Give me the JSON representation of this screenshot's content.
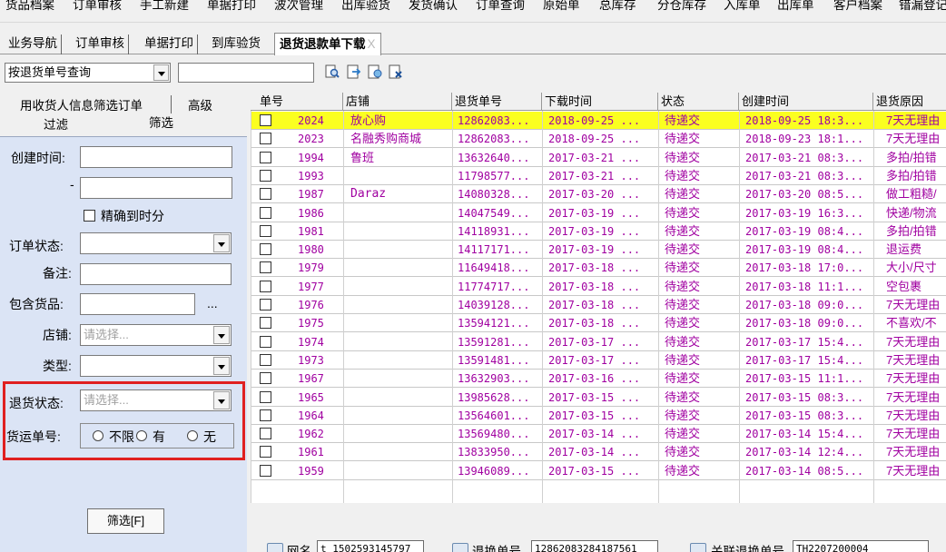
{
  "menu": [
    "货品档案",
    "订单审核",
    "手工新建",
    "单据打印",
    "波次管理",
    "出库验货",
    "发货确认",
    "订单查询",
    "原始单",
    "总库存",
    "分仓库存",
    "入库单",
    "出库单",
    "客户档案",
    "错漏登记"
  ],
  "tabs": [
    {
      "label": "业务导航"
    },
    {
      "label": "订单审核"
    },
    {
      "label": "单据打印"
    },
    {
      "label": "到库验货"
    },
    {
      "label": "退货退款单下载",
      "close": "X"
    }
  ],
  "search": {
    "mode": "按退货单号查询",
    "value": ""
  },
  "toolbar_icons": [
    "search-icon",
    "import-icon",
    "export-icon",
    "clear-icon"
  ],
  "left_tabs": {
    "row1_a": "用收货人信息筛选订单",
    "row1_b": "高级",
    "row2_a": "过滤",
    "row2_b": "筛选"
  },
  "filter": {
    "created_time": "创建时间:",
    "dash": "-",
    "precise": "精确到时分",
    "order_status": "订单状态:",
    "note": "备注:",
    "contains_goods": "包含货品:",
    "dots": "...",
    "shop": "店铺:",
    "shop_placeholder": "请选择...",
    "type": "类型:",
    "return_status": "退货状态:",
    "return_placeholder": "请选择...",
    "tracking_no": "货运单号:",
    "radio_all": "不限",
    "radio_yes": "有",
    "radio_no": "无",
    "filter_button": "筛选[F]"
  },
  "columns": [
    "单号",
    "店铺",
    "退货单号",
    "下载时间",
    "状态",
    "创建时间",
    "退货原因"
  ],
  "rows": [
    {
      "no": "2024",
      "shop": "放心购",
      "refund": "12862083...",
      "dl": "2018-09-25 ...",
      "status": "待递交",
      "created": "2018-09-25 18:3...",
      "reason": "7天无理由"
    },
    {
      "no": "2023",
      "shop": "名融秀购商城",
      "refund": "12862083...",
      "dl": "2018-09-25 ...",
      "status": "待递交",
      "created": "2018-09-23 18:1...",
      "reason": "7天无理由"
    },
    {
      "no": "1994",
      "shop": "鲁班",
      "refund": "13632640...",
      "dl": "2017-03-21 ...",
      "status": "待递交",
      "created": "2017-03-21 08:3...",
      "reason": "多拍/拍错"
    },
    {
      "no": "1993",
      "shop": "",
      "refund": "11798577...",
      "dl": "2017-03-21 ...",
      "status": "待递交",
      "created": "2017-03-21 08:3...",
      "reason": "多拍/拍错"
    },
    {
      "no": "1987",
      "shop": "Daraz",
      "refund": "14080328...",
      "dl": "2017-03-20 ...",
      "status": "待递交",
      "created": "2017-03-20 08:5...",
      "reason": "做工粗糙/"
    },
    {
      "no": "1986",
      "shop": "",
      "refund": "14047549...",
      "dl": "2017-03-19 ...",
      "status": "待递交",
      "created": "2017-03-19 16:3...",
      "reason": "快递/物流"
    },
    {
      "no": "1981",
      "shop": "",
      "refund": "14118931...",
      "dl": "2017-03-19 ...",
      "status": "待递交",
      "created": "2017-03-19 08:4...",
      "reason": "多拍/拍错"
    },
    {
      "no": "1980",
      "shop": "",
      "refund": "14117171...",
      "dl": "2017-03-19 ...",
      "status": "待递交",
      "created": "2017-03-19 08:4...",
      "reason": "退运费"
    },
    {
      "no": "1979",
      "shop": "",
      "refund": "11649418...",
      "dl": "2017-03-18 ...",
      "status": "待递交",
      "created": "2017-03-18 17:0...",
      "reason": "大小/尺寸"
    },
    {
      "no": "1977",
      "shop": "",
      "refund": "11774717...",
      "dl": "2017-03-18 ...",
      "status": "待递交",
      "created": "2017-03-18 11:1...",
      "reason": "空包裹"
    },
    {
      "no": "1976",
      "shop": "",
      "refund": "14039128...",
      "dl": "2017-03-18 ...",
      "status": "待递交",
      "created": "2017-03-18 09:0...",
      "reason": "7天无理由"
    },
    {
      "no": "1975",
      "shop": "",
      "refund": "13594121...",
      "dl": "2017-03-18 ...",
      "status": "待递交",
      "created": "2017-03-18 09:0...",
      "reason": "不喜欢/不"
    },
    {
      "no": "1974",
      "shop": "",
      "refund": "13591281...",
      "dl": "2017-03-17 ...",
      "status": "待递交",
      "created": "2017-03-17 15:4...",
      "reason": "7天无理由"
    },
    {
      "no": "1973",
      "shop": "",
      "refund": "13591481...",
      "dl": "2017-03-17 ...",
      "status": "待递交",
      "created": "2017-03-17 15:4...",
      "reason": "7天无理由"
    },
    {
      "no": "1967",
      "shop": "",
      "refund": "13632903...",
      "dl": "2017-03-16 ...",
      "status": "待递交",
      "created": "2017-03-15 11:1...",
      "reason": "7天无理由"
    },
    {
      "no": "1965",
      "shop": "",
      "refund": "13985628...",
      "dl": "2017-03-15 ...",
      "status": "待递交",
      "created": "2017-03-15 08:3...",
      "reason": "7天无理由"
    },
    {
      "no": "1964",
      "shop": "",
      "refund": "13564601...",
      "dl": "2017-03-15 ...",
      "status": "待递交",
      "created": "2017-03-15 08:3...",
      "reason": "7天无理由"
    },
    {
      "no": "1962",
      "shop": "",
      "refund": "13569480...",
      "dl": "2017-03-14 ...",
      "status": "待递交",
      "created": "2017-03-14 15:4...",
      "reason": "7天无理由"
    },
    {
      "no": "1961",
      "shop": "",
      "refund": "13833950...",
      "dl": "2017-03-14 ...",
      "status": "待递交",
      "created": "2017-03-14 12:4...",
      "reason": "7天无理由"
    },
    {
      "no": "1959",
      "shop": "",
      "refund": "13946089...",
      "dl": "2017-03-15 ...",
      "status": "待递交",
      "created": "2017-03-14 08:5...",
      "reason": "7天无理由"
    }
  ],
  "bottom": {
    "wangming_label": "网名",
    "wangming_value": "t_1502593145797",
    "refund_label": "退换单号",
    "refund_value": "12862083284187561",
    "related_label": "关联退换单号",
    "related_value": "TH2207200004"
  },
  "colors": {
    "selected_row": "#fbff20",
    "row_text": "#a000a0",
    "highlight_border": "#e02020",
    "panel_bg": "#dbe4f5"
  }
}
